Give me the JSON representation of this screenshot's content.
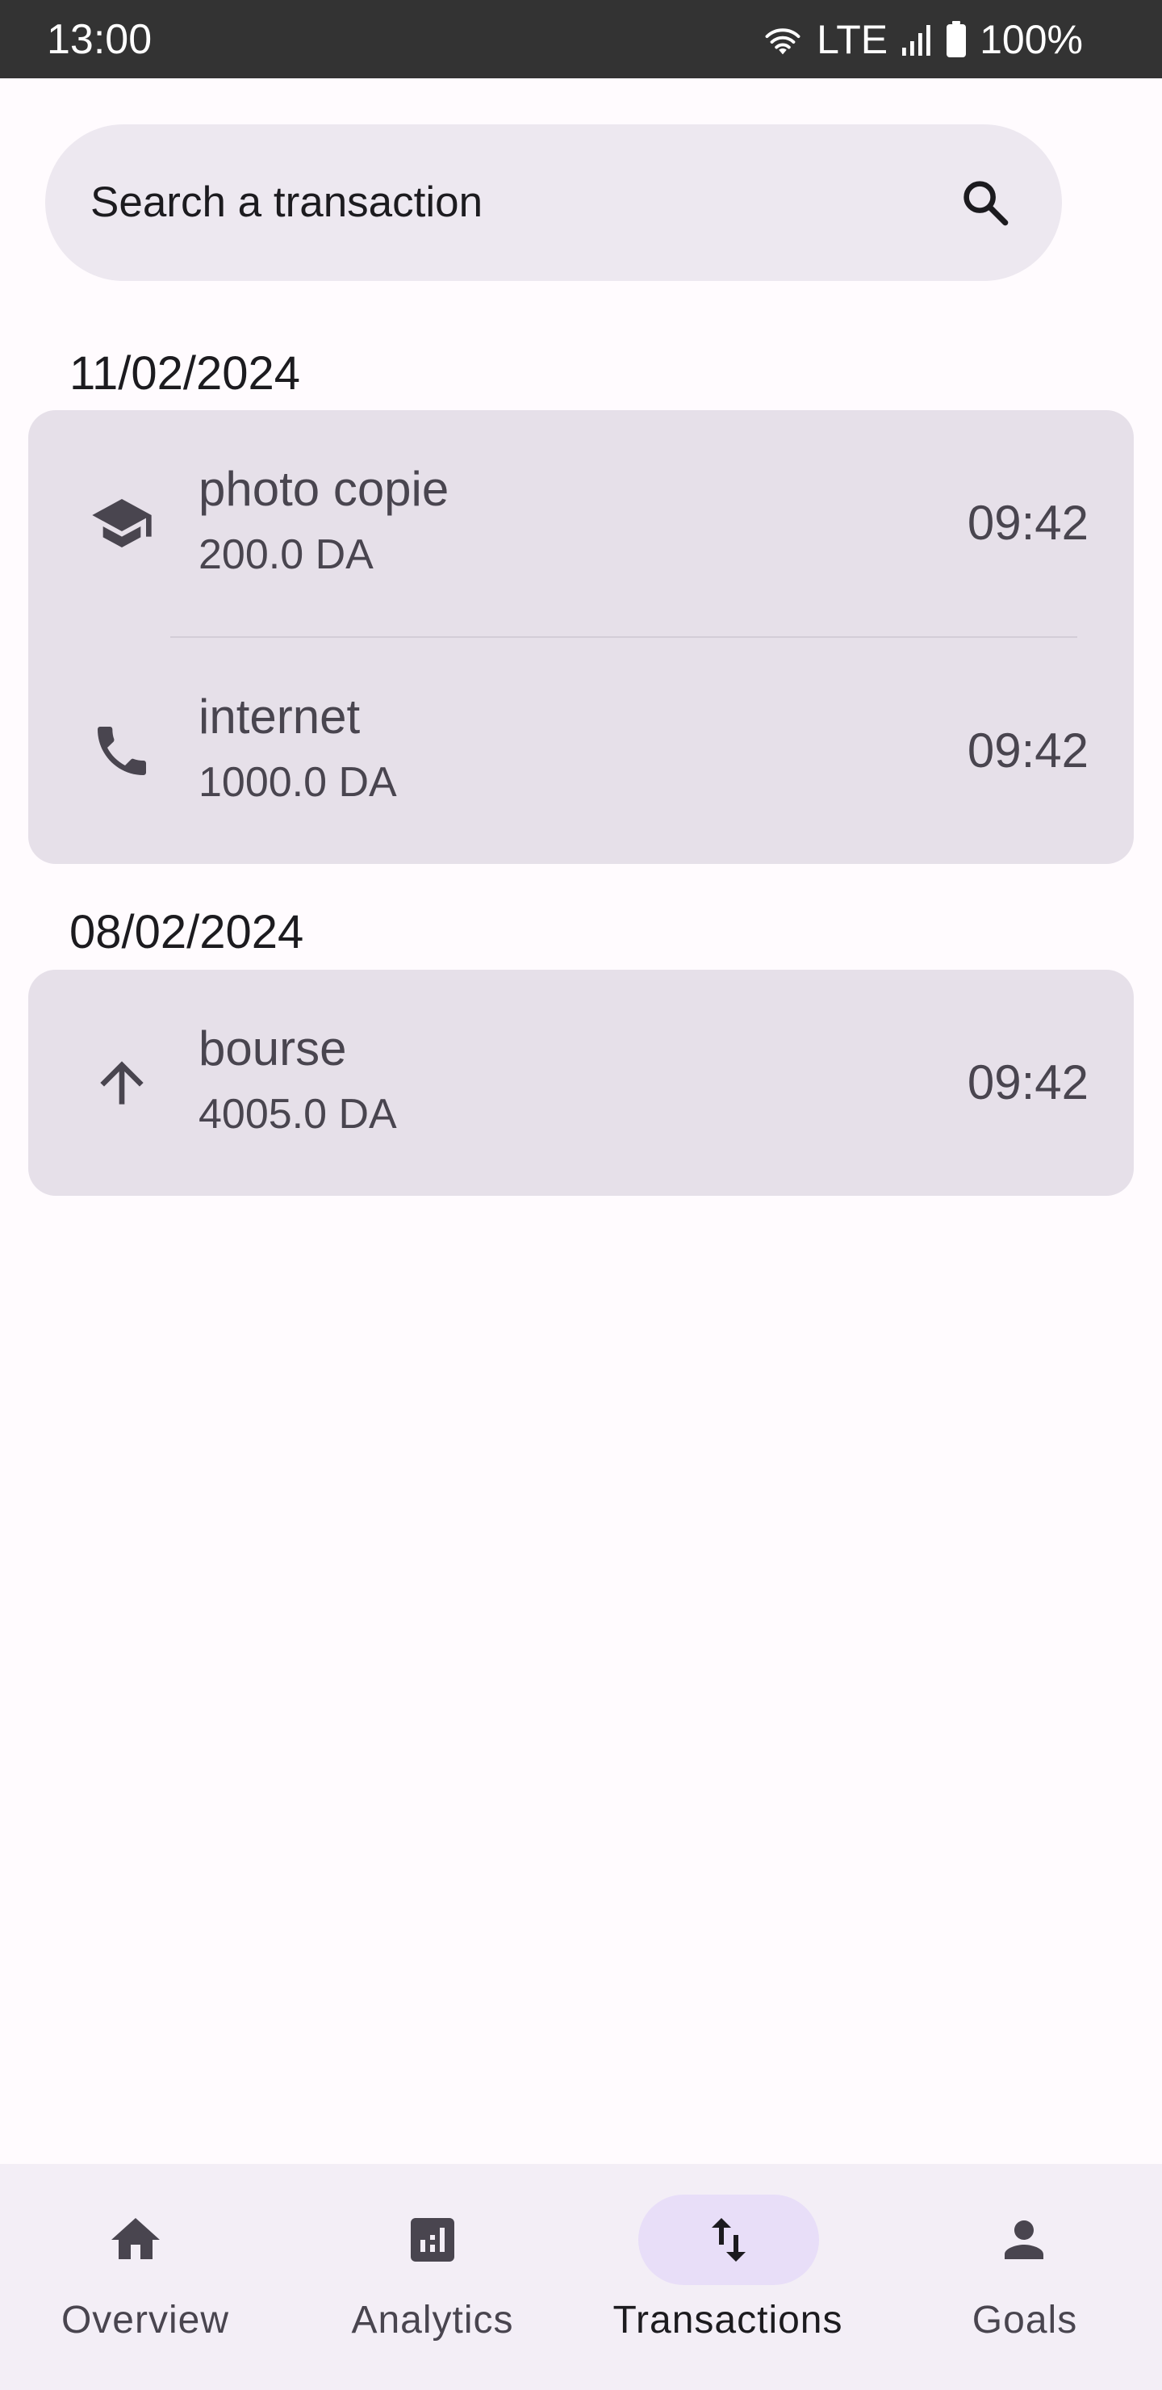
{
  "status_bar": {
    "time": "13:00",
    "network": "LTE",
    "battery": "100%",
    "icons": [
      "wifi-icon",
      "signal-icon",
      "battery-icon"
    ]
  },
  "search": {
    "placeholder": "Search a transaction",
    "icon": "search-icon"
  },
  "groups": [
    {
      "date": "11/02/2024",
      "transactions": [
        {
          "name": "photo copie",
          "amount": "200.0 DA",
          "time": "09:42",
          "icon": "school-icon"
        },
        {
          "name": "internet",
          "amount": "1000.0 DA",
          "time": "09:42",
          "icon": "phone-icon"
        }
      ]
    },
    {
      "date": "08/02/2024",
      "transactions": [
        {
          "name": "bourse",
          "amount": "4005.0 DA",
          "time": "09:42",
          "icon": "arrow-up-icon"
        }
      ]
    }
  ],
  "nav": {
    "items": [
      {
        "label": "Overview",
        "icon": "home-icon",
        "active": false
      },
      {
        "label": "Analytics",
        "icon": "analytics-icon",
        "active": false
      },
      {
        "label": "Transactions",
        "icon": "swap-vert-icon",
        "active": true
      },
      {
        "label": "Goals",
        "icon": "person-icon",
        "active": false
      }
    ]
  },
  "colors": {
    "background": "#fffbfe",
    "status_bar": "#333333",
    "search_bg": "#ede8f0",
    "card_bg": "#e6e0e9",
    "nav_bg": "#f3eef6",
    "nav_active_pill": "#e8def8",
    "text_primary": "#1c1b1f",
    "text_secondary": "#49454f"
  }
}
